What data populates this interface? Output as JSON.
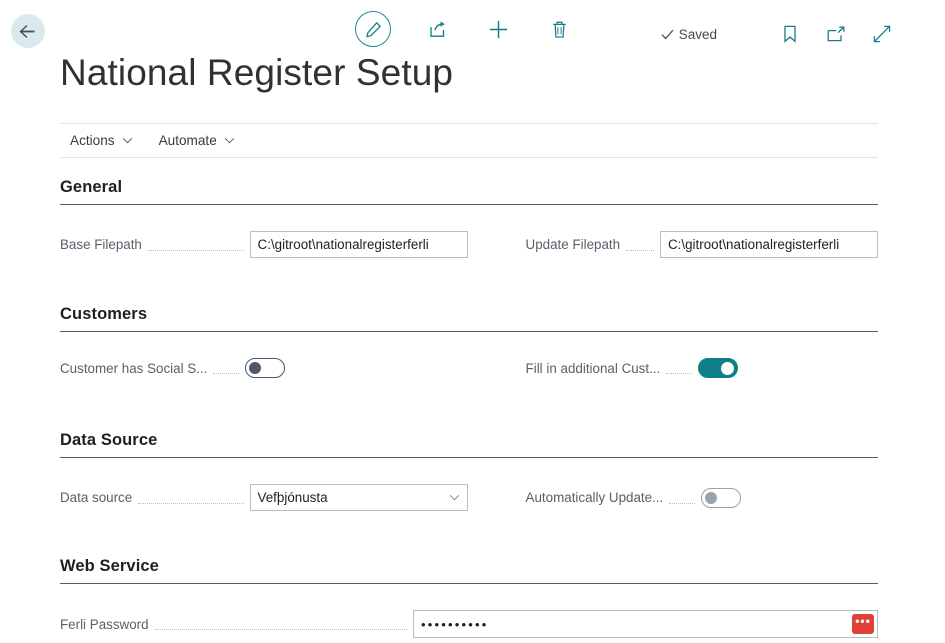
{
  "topbar": {
    "back_icon": "arrow-left-icon",
    "commands": [
      {
        "name": "edit-button",
        "icon": "pencil-icon",
        "label": "Edit"
      },
      {
        "name": "share-button",
        "icon": "share-icon",
        "label": "Share"
      },
      {
        "name": "new-button",
        "icon": "plus-icon",
        "label": "New"
      },
      {
        "name": "delete-button",
        "icon": "trash-icon",
        "label": "Delete"
      }
    ],
    "saved_status": "Saved",
    "saved_icon": "checkmark-icon",
    "right_commands": [
      {
        "name": "bookmark-button",
        "icon": "bookmark-icon",
        "label": "Bookmark"
      },
      {
        "name": "open-in-new-window-button",
        "icon": "open-new-window-icon",
        "label": "Open in new window"
      },
      {
        "name": "expand-button",
        "icon": "expand-diagonal-icon",
        "label": "Expand"
      }
    ],
    "accent_color": "#0f7b86",
    "back_bg_color": "#d9eaee"
  },
  "page": {
    "title": "National Register Setup"
  },
  "actionbar": {
    "items": [
      {
        "label": "Actions",
        "icon": "chevron-down-icon"
      },
      {
        "label": "Automate",
        "icon": "chevron-down-icon"
      }
    ]
  },
  "sections": {
    "general": {
      "title": "General",
      "base_filepath": {
        "label": "Base Filepath",
        "value": "C:\\gitroot\\nationalregisterferli"
      },
      "update_filepath": {
        "label": "Update Filepath",
        "value": "C:\\gitroot\\nationalregisterferli"
      }
    },
    "customers": {
      "title": "Customers",
      "customer_has_social": {
        "label": "Customer has Social S...",
        "state": "off"
      },
      "fill_additional": {
        "label": "Fill in additional Cust...",
        "state": "on"
      }
    },
    "data_source": {
      "title": "Data Source",
      "data_source": {
        "label": "Data source",
        "value": "Vefþjónusta",
        "icon": "chevron-down-icon"
      },
      "auto_update": {
        "label": "Automatically Update...",
        "state": "off"
      }
    },
    "web_service": {
      "title": "Web Service",
      "ferli_password": {
        "label": "Ferli Password",
        "value": "••••••••••",
        "assist_label": "•••",
        "assist_color": "#e0413b"
      }
    }
  }
}
